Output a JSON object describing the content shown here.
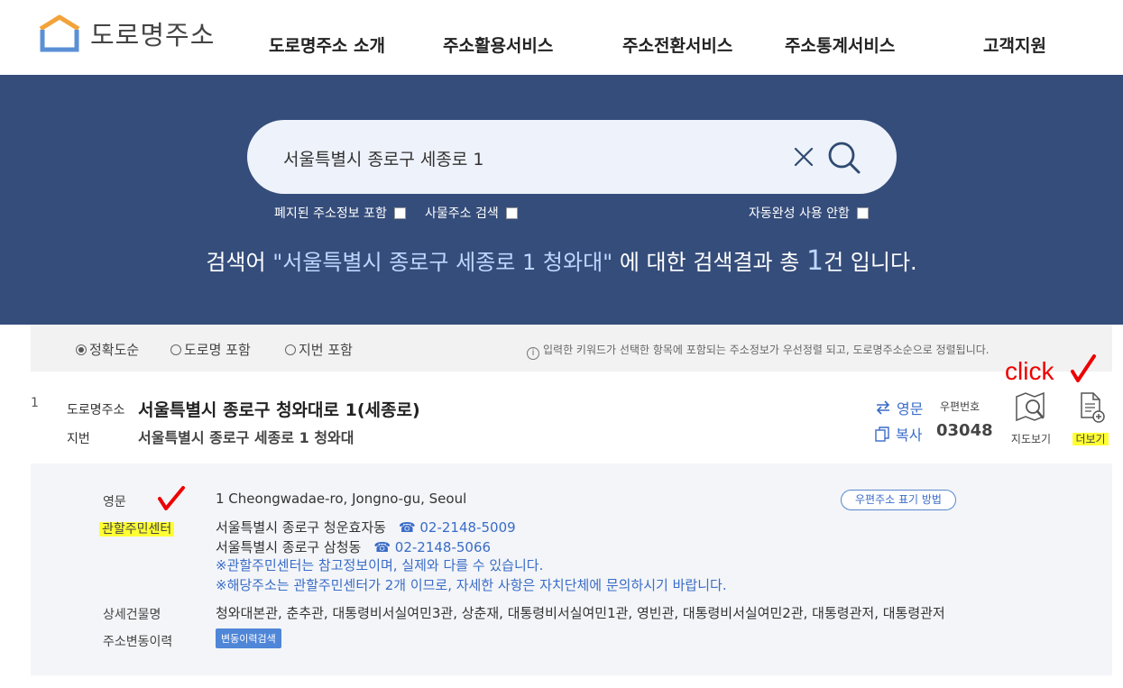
{
  "header": {
    "logo_text": "도로명주소",
    "nav": [
      "도로명주소 소개",
      "주소활용서비스",
      "주소전환서비스",
      "주소통계서비스",
      "고객지원"
    ]
  },
  "search": {
    "query": "서울특별시 종로구 세종로 1",
    "options": {
      "include_abolished": "폐지된 주소정보 포함",
      "thing_address": "사물주소 검색",
      "no_autocomplete": "자동완성 사용 안함"
    },
    "result_prefix": "검색어 ",
    "result_keyword": "\"서울특별시 종로구 세종로 1 청와대\"",
    "result_mid": " 에 대한 검색결과 총 ",
    "result_count": "1",
    "result_suffix": "건 입니다."
  },
  "sort": {
    "options": [
      "정확도순",
      "도로명 포함",
      "지번 포함"
    ],
    "selected": "정확도순",
    "note": "입력한 키워드가 선택한 항목에 포함되는 주소정보가 우선정렬 되고, 도로명주소순으로 정렬됩니다."
  },
  "result": {
    "index": "1",
    "road_label": "도로명주소",
    "road_address": "서울특별시 종로구 청와대로 1(세종로)",
    "jibun_label": "지번",
    "jibun_address": "서울특별시 종로구 세종로 1 청와대",
    "english_btn": "영문",
    "copy_btn": "복사",
    "zip_label": "우편번호",
    "zip": "03048",
    "map_btn": "지도보기",
    "more_btn": "더보기"
  },
  "annotation": {
    "click_text": "click",
    "color": "#ee0000"
  },
  "detail": {
    "english_label": "영문",
    "english_value": "1 Cheongwadae-ro, Jongno-gu, Seoul",
    "postal_pill": "우편주소 표기 방법",
    "center_label": "관할주민센터",
    "centers": [
      {
        "name": "서울특별시 종로구 청운효자동",
        "phone": "02-2148-5009"
      },
      {
        "name": "서울특별시 종로구 삼청동",
        "phone": "02-2148-5066"
      }
    ],
    "note1": "※관할주민센터는 참고정보이며, 실제와 다를 수 있습니다.",
    "note2": "※해당주소는 관할주민센터가 2개 이므로, 자세한 사항은 자치단체에 문의하시기 바랍니다.",
    "building_label": "상세건물명",
    "building_value": "청와대본관, 춘추관, 대통령비서실여민3관, 상춘재, 대통령비서실여민1관, 영빈관, 대통령비서실여민2관, 대통령관저, 대통령관저",
    "history_label": "주소변동이력",
    "history_btn": "변동이력검색"
  },
  "colors": {
    "hero_bg": "#354d7b",
    "accent_blue": "#3a6cc7",
    "highlight": "#ffff33"
  }
}
